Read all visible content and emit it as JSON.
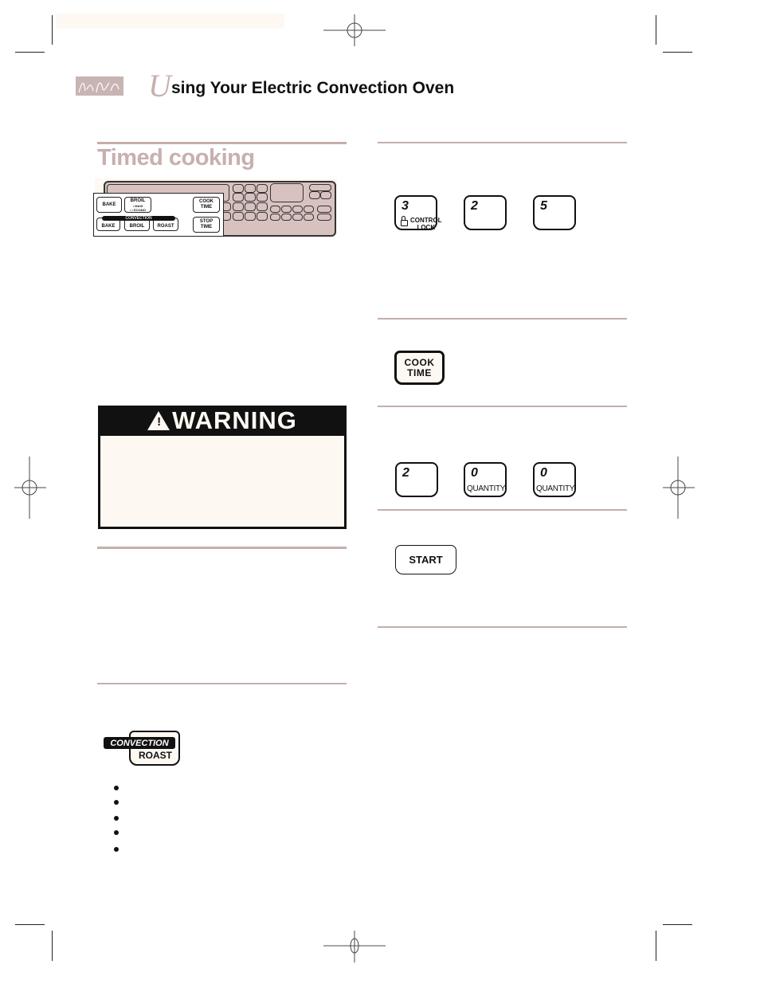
{
  "header": {
    "drop_cap": "U",
    "title_rest": "sing Your Electric Convection Oven"
  },
  "section": {
    "title": "Timed cooking"
  },
  "control_panel": {
    "buttons": {
      "bake": "BAKE",
      "broil": "BROIL",
      "broil_sub1": "• MAXI",
      "broil_sub2": "• • ECONO",
      "cook_time_1": "COOK",
      "cook_time_2": "TIME",
      "stop_time_1": "STOP",
      "stop_time_2": "TIME",
      "convection": "CONVECTION",
      "conv_bake": "BAKE",
      "conv_broil": "BROIL",
      "conv_roast": "ROAST"
    }
  },
  "warning": {
    "label": "WARNING",
    "icon": "!"
  },
  "steps": {
    "temp_keys": [
      {
        "num": "3",
        "sub1": "CONTROL",
        "sub2": "LOCK"
      },
      {
        "num": "2"
      },
      {
        "num": "5"
      }
    ],
    "cook_time_key": {
      "line1": "COOK",
      "line2": "TIME"
    },
    "time_keys": [
      {
        "num": "2"
      },
      {
        "num": "0",
        "sub": "QUANTITY"
      },
      {
        "num": "0",
        "sub": "QUANTITY"
      }
    ],
    "start_key": "START"
  },
  "convection_roast_key": {
    "line1": "CONVECTION",
    "line2": "ROAST"
  },
  "bullets_count": 5
}
